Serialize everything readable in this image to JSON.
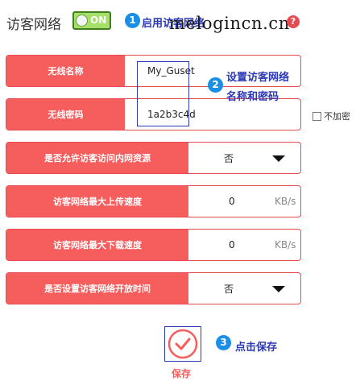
{
  "header": {
    "title": "访客网络",
    "toggle_label": "ON",
    "watermark": "melogincn.cn",
    "help_glyph": "?"
  },
  "annotations": [
    {
      "number": "1",
      "text": "启用访客网络"
    },
    {
      "number": "2",
      "line1": "设置访客网络",
      "line2": "名称和密码"
    },
    {
      "number": "3",
      "text": "点击保存"
    }
  ],
  "form": {
    "ssid_label": "无线名称",
    "ssid_value": "My_Guset",
    "password_label": "无线密码",
    "password_value": "1a2b3c4d",
    "no_encrypt_label": "不加密",
    "lan_access_label": "是否允许访客访问内网资源",
    "lan_access_value": "否",
    "upload_label": "访客网络最大上传速度",
    "upload_value": "0",
    "upload_unit": "KB/s",
    "download_label": "访客网络最大下载速度",
    "download_value": "0",
    "download_unit": "KB/s",
    "schedule_label": "是否设置访客网络开放时间",
    "schedule_value": "否"
  },
  "actions": {
    "save_label": "保存"
  },
  "colors": {
    "accent": "#f65d5d",
    "annotation": "#2b39b5",
    "badge": "#1a8fe8",
    "toggle_on": "#a6e06a"
  }
}
